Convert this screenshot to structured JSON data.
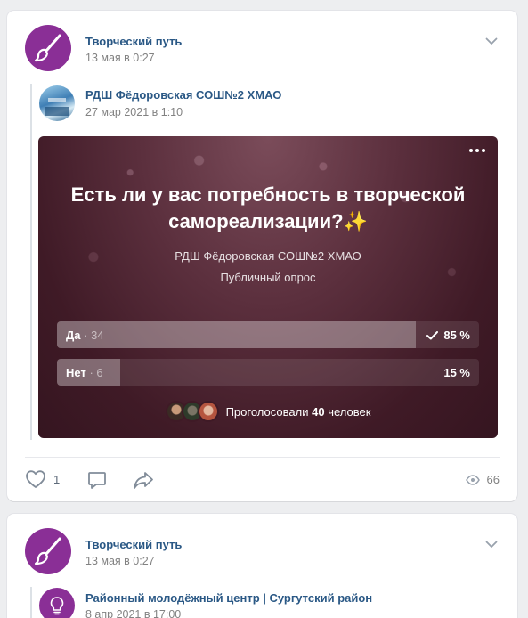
{
  "post1": {
    "author": "Творческий путь",
    "date": "13 мая в 0:27",
    "repost": {
      "author": "РДШ Фёдоровская СОШ№2 ХМАО",
      "date": "27 мар 2021 в 1:10"
    },
    "poll": {
      "question": "Есть ли у вас потребность в творческой самореализации?",
      "question_emoji": "✨",
      "author": "РДШ Фёдоровская СОШ№2 ХМАО",
      "type": "Публичный опрос",
      "options": [
        {
          "label": "Да",
          "count": "34",
          "percent": "85 %",
          "fraction": 0.85,
          "voted": true
        },
        {
          "label": "Нет",
          "count": "6",
          "percent": "15 %",
          "fraction": 0.15,
          "voted": false
        }
      ],
      "voters_prefix": "Проголосовали",
      "voters_count": "40",
      "voters_suffix": "человек"
    },
    "likes": "1",
    "views": "66"
  },
  "post2": {
    "author": "Творческий путь",
    "date": "13 мая в 0:27",
    "repost": {
      "author": "Районный молодёжный центр | Сургутский район",
      "date": "8 апр 2021 в 17:00"
    }
  },
  "colors": {
    "accent": "#2a5885",
    "brand_avatar": "#8a2f96"
  }
}
